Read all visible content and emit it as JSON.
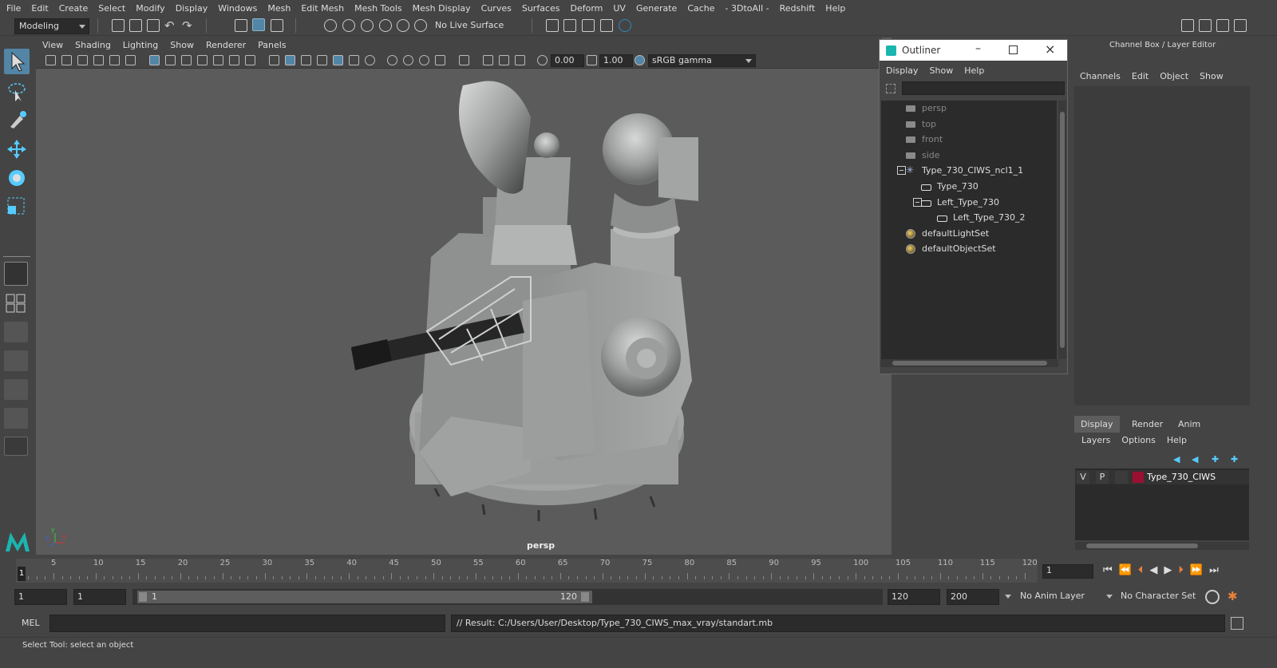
{
  "menus": [
    "File",
    "Edit",
    "Create",
    "Select",
    "Modify",
    "Display",
    "Windows",
    "Mesh",
    "Edit Mesh",
    "Mesh Tools",
    "Mesh Display",
    "Curves",
    "Surfaces",
    "Deform",
    "UV",
    "Generate",
    "Cache",
    "- 3DtoAll -",
    "Redshift",
    "Help"
  ],
  "shelf": {
    "mode": "Modeling",
    "live_surface": "No Live Surface"
  },
  "viewport": {
    "menus": [
      "View",
      "Shading",
      "Lighting",
      "Show",
      "Renderer",
      "Panels"
    ],
    "value_a": "0.00",
    "value_b": "1.00",
    "color_space": "sRGB gamma",
    "camera_label": "persp",
    "axis_labels": {
      "y": "y",
      "x": "x",
      "z": "z"
    }
  },
  "outliner": {
    "title": "Outliner",
    "menus": [
      "Display",
      "Show",
      "Help"
    ],
    "items": [
      {
        "label": "persp",
        "icon": "camera-icon",
        "dim": true
      },
      {
        "label": "top",
        "icon": "camera-icon",
        "dim": true
      },
      {
        "label": "front",
        "icon": "camera-icon",
        "dim": true
      },
      {
        "label": "side",
        "icon": "camera-icon",
        "dim": true
      },
      {
        "label": "Type_730_CIWS_ncl1_1",
        "icon": "group-icon",
        "dim": false
      },
      {
        "label": "Type_730",
        "icon": "shape-icon",
        "dim": false
      },
      {
        "label": "Left_Type_730",
        "icon": "shape-icon",
        "dim": false
      },
      {
        "label": "Left_Type_730_2",
        "icon": "shape-icon",
        "dim": false
      },
      {
        "label": "defaultLightSet",
        "icon": "set-icon",
        "dim": false
      },
      {
        "label": "defaultObjectSet",
        "icon": "set-icon",
        "dim": false
      }
    ]
  },
  "channel_box": {
    "title": "Channel Box / Layer Editor",
    "menus": [
      "Channels",
      "Edit",
      "Object",
      "Show"
    ]
  },
  "layer_editor": {
    "tabs": [
      "Display",
      "Render",
      "Anim"
    ],
    "menus": [
      "Layers",
      "Options",
      "Help"
    ],
    "layer": {
      "v": "V",
      "p": "P",
      "name": "Type_730_CIWS",
      "color": "#9b1030"
    }
  },
  "timeline": {
    "ticks": [
      "5",
      "10",
      "15",
      "20",
      "25",
      "30",
      "35",
      "40",
      "45",
      "50",
      "55",
      "60",
      "65",
      "70",
      "75",
      "80",
      "85",
      "90",
      "95",
      "100",
      "105",
      "110",
      "115",
      "120"
    ],
    "current_frame": "1",
    "frame_field": "1"
  },
  "range": {
    "start": "1",
    "start_inner": "1",
    "slider_start": "1",
    "slider_end": "120",
    "end": "120",
    "end_outer": "200",
    "anim_layer": "No Anim Layer",
    "character_set": "No Character Set"
  },
  "command": {
    "lang": "MEL",
    "result": "// Result: C:/Users/User/Desktop/Type_730_CIWS_max_vray/standart.mb"
  },
  "status": {
    "help": "Select Tool: select an object"
  }
}
